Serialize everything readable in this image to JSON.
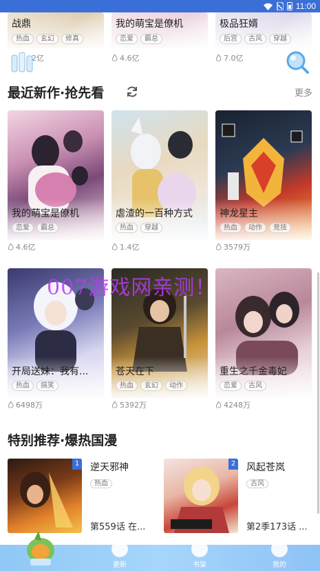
{
  "status_bar": {
    "time": "11:00"
  },
  "top_row": [
    {
      "title": "战鼎",
      "tags": [
        "热血",
        "玄幻",
        "修真"
      ],
      "views": "2亿"
    },
    {
      "title": "我的萌宝是僚机",
      "tags": [
        "恋爱",
        "霸总"
      ],
      "views": "4.6亿"
    },
    {
      "title": "极品狂婿",
      "tags": [
        "后宫",
        "古风",
        "穿越"
      ],
      "views": "7.0亿"
    }
  ],
  "section_new": {
    "title": "最近新作·抢先看",
    "more": "更多",
    "row1": [
      {
        "title": "我的萌宝是僚机",
        "tags": [
          "恋爱",
          "霸总"
        ],
        "views": "4.6亿"
      },
      {
        "title": "虐渣的一百种方式",
        "tags": [
          "热血",
          "穿越"
        ],
        "views": "1.4亿"
      },
      {
        "title": "神龙星主",
        "tags": [
          "热血",
          "动作",
          "竞技"
        ],
        "views": "3579万"
      }
    ],
    "row2": [
      {
        "title": "开局送妹：我有...",
        "tags": [
          "热血",
          "搞笑"
        ],
        "views": "6498万"
      },
      {
        "title": "苍天在下",
        "tags": [
          "热血",
          "玄幻",
          "动作"
        ],
        "views": "5392万"
      },
      {
        "title": "重生之千金毒妃",
        "tags": [
          "恋爱",
          "古风"
        ],
        "views": "4248万"
      }
    ]
  },
  "watermark": "007游戏网亲测！",
  "section_hot": {
    "title": "特别推荐·爆热国漫",
    "items": [
      {
        "rank": "1",
        "title": "逆天邪神",
        "tag": "热血",
        "chapter": "第559话 在..."
      },
      {
        "rank": "2",
        "title": "风起苍岚",
        "tag": "古风",
        "chapter": "第2季173话 ..."
      }
    ]
  },
  "tabbar": {
    "update": "更新",
    "shelf": "书架",
    "mine": "我的"
  },
  "colors": {
    "accent": "#3a6fd8",
    "tabbar": "#9fd1fa"
  }
}
